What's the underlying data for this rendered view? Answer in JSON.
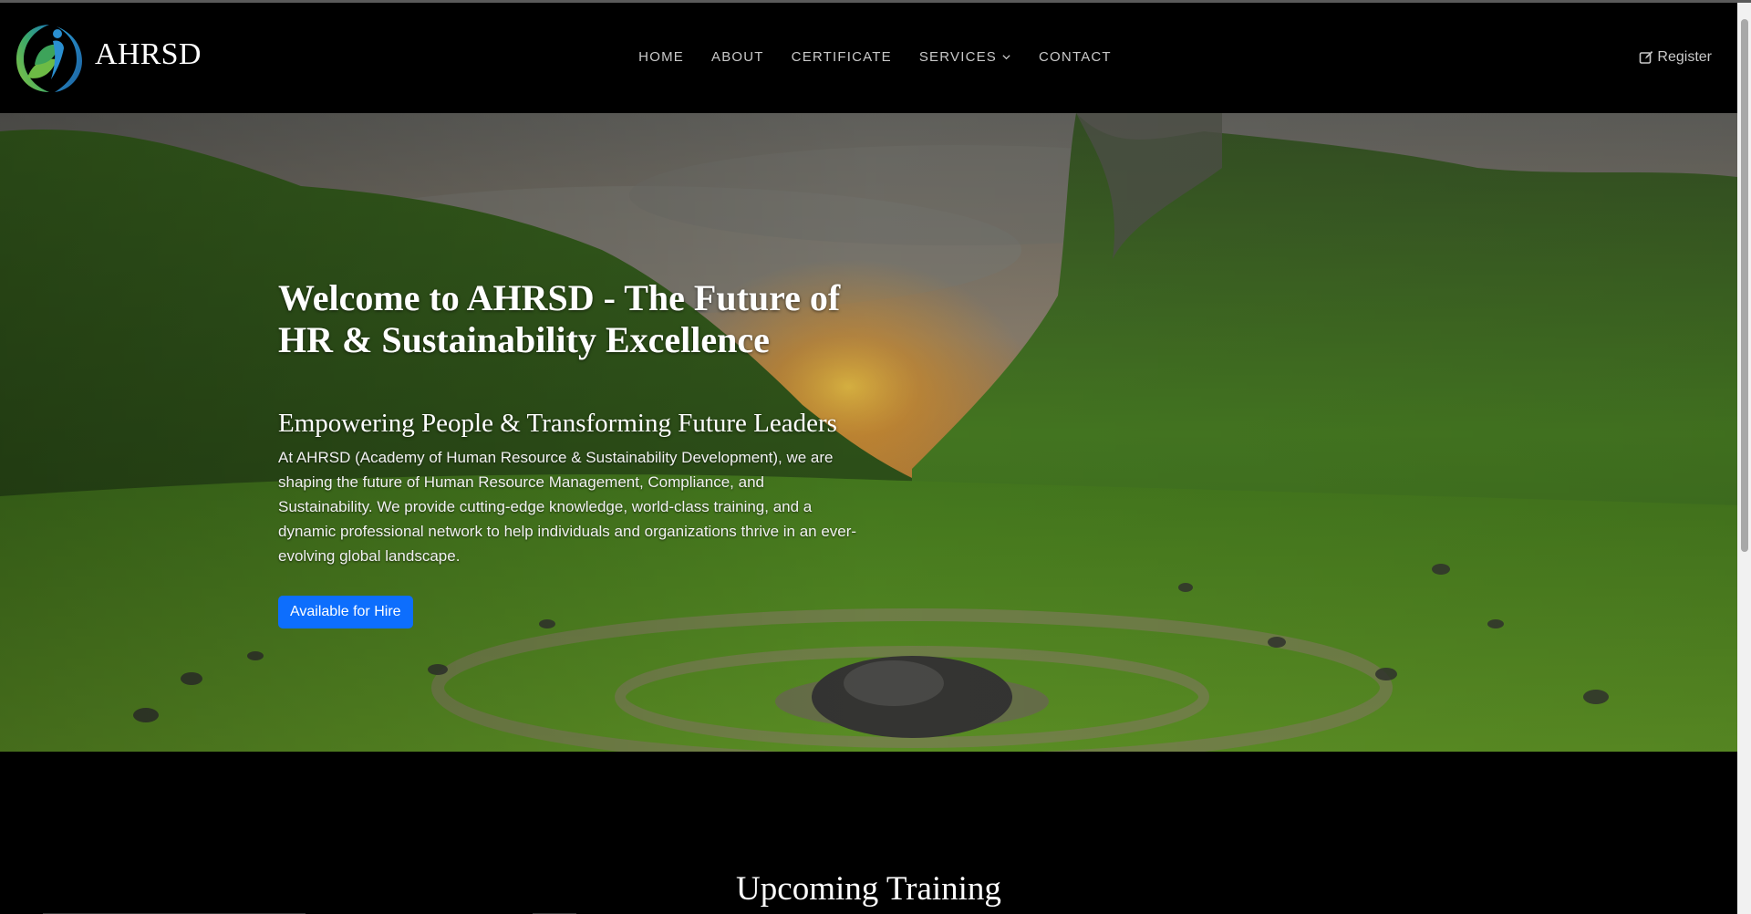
{
  "header": {
    "brand_name": "AHRSD",
    "nav_items": [
      "HOME",
      "ABOUT",
      "CERTIFICATE",
      "SERVICES",
      "CONTACT"
    ],
    "register_label": "Register"
  },
  "hero": {
    "title": "Welcome to AHRSD - The Future of HR & Sustainability Excellence",
    "subtitle": "Empowering People & Transforming Future Leaders",
    "description": "At AHRSD (Academy of Human Resource & Sustainability Development), we are shaping the future of Human Resource Management, Compliance, and Sustainability. We provide cutting-edge knowledge, world-class training, and a dynamic professional network to help individuals and organizations thrive in an ever-evolving global landscape.",
    "cta_label": "Available for Hire"
  },
  "training": {
    "title": "Upcoming Training"
  },
  "icons": {
    "logo": "leaf-person-logo-icon",
    "services_caret": "chevron-down-icon",
    "register": "edit-icon"
  },
  "colors": {
    "background": "#000000",
    "nav_text": "#c9c9c9",
    "primary_button": "#0d6efd"
  }
}
